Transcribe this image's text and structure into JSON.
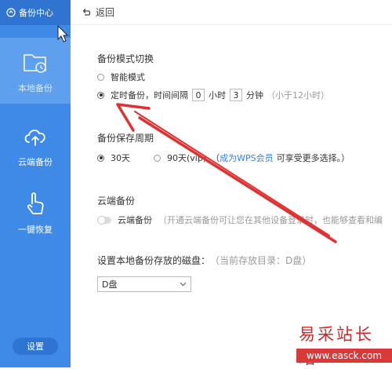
{
  "sidebar": {
    "header": "备份中心",
    "items": [
      {
        "label": "本地备份",
        "icon": "folder-clock-icon"
      },
      {
        "label": "云端备份",
        "icon": "cloud-upload-icon"
      },
      {
        "label": "一键恢复",
        "icon": "hand-tap-icon"
      }
    ],
    "settings_label": "设置"
  },
  "topbar": {
    "back_label": "返回"
  },
  "backup_mode": {
    "title": "备份模式切换",
    "smart_label": "智能模式",
    "timed_label": "定时备份，时间间隔",
    "hours_value": "0",
    "hours_unit": "小时",
    "minutes_value": "3",
    "minutes_unit": "分钟",
    "hint": "（小于12小时）"
  },
  "retention": {
    "title": "备份保存周期",
    "opt30_label": "30天",
    "opt90_label": "90天(vip)",
    "note_open": "（",
    "note_link": "成为WPS会员",
    "note_rest": "可享受更多选择。）"
  },
  "cloud": {
    "title": "云端备份",
    "toggle_label": "云端备份",
    "desc": "（开通云端备份可让您在其他设备登录时，也能够查看和编"
  },
  "disk": {
    "title": "设置本地备份存放的磁盘：",
    "current": "（当前存放目录：D盘）",
    "selected": "D盘"
  },
  "watermark": {
    "cn": "易采站长站",
    "url": "www.easck.com"
  },
  "colors": {
    "sidebar": "#3f8ae6",
    "accent": "#3a7fdc",
    "annotation": "#e03030"
  }
}
